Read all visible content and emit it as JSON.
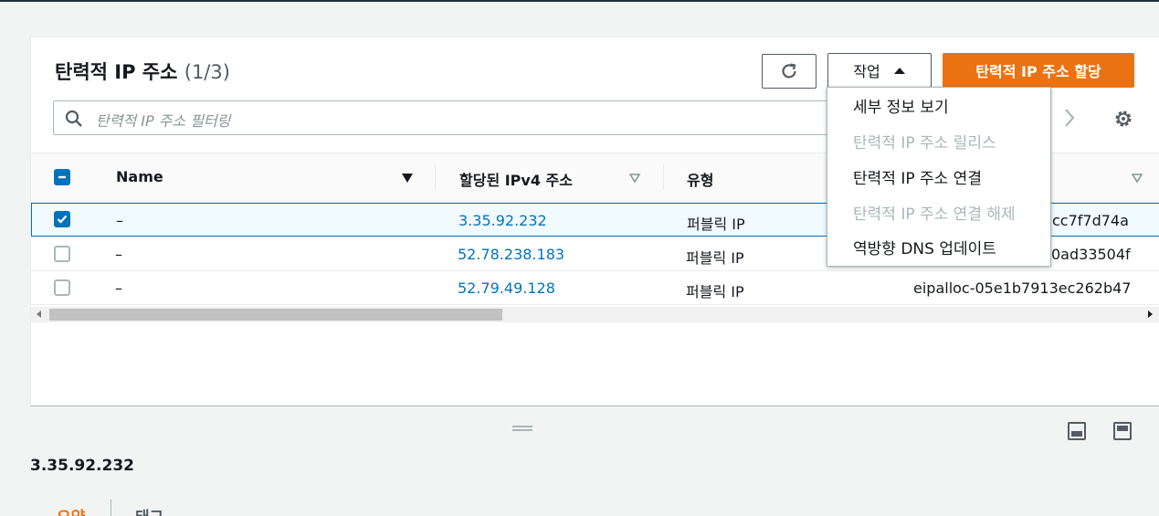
{
  "panel": {
    "title": "탄력적 IP 주소",
    "count": "(1/3)",
    "refresh_label": "",
    "actions_label": "작업",
    "primary_label": "탄력적 IP 주소 할당",
    "search_placeholder": "탄력적 IP 주소 필터링"
  },
  "table": {
    "headers": {
      "name": "Name",
      "ipv4": "할당된 IPv4 주소",
      "type": "유형"
    },
    "rows": [
      {
        "checked": true,
        "name": "–",
        "ip": "3.35.92.232",
        "type": "퍼블릭 IP",
        "alloc": "cc7f7d74a"
      },
      {
        "checked": false,
        "name": "–",
        "ip": "52.78.238.183",
        "type": "퍼블릭 IP",
        "alloc": "0ad33504f"
      },
      {
        "checked": false,
        "name": "–",
        "ip": "52.79.49.128",
        "type": "퍼블릭 IP",
        "alloc": "eipalloc-05e1b7913ec262b47"
      }
    ]
  },
  "actions_menu": {
    "items": [
      {
        "label": "세부 정보 보기",
        "disabled": false
      },
      {
        "label": "탄력적 IP 주소 릴리스",
        "disabled": true
      },
      {
        "label": "탄력적 IP 주소 연결",
        "disabled": false
      },
      {
        "label": "탄력적 IP 주소 연결 해제",
        "disabled": true
      },
      {
        "label": "역방향 DNS 업데이트",
        "disabled": false
      }
    ]
  },
  "detail": {
    "title": "3.35.92.232",
    "tabs": [
      "요약",
      "태그"
    ]
  },
  "colors": {
    "accent": "#ec7211",
    "link": "#0073bb",
    "disabled": "#aab7b8"
  }
}
